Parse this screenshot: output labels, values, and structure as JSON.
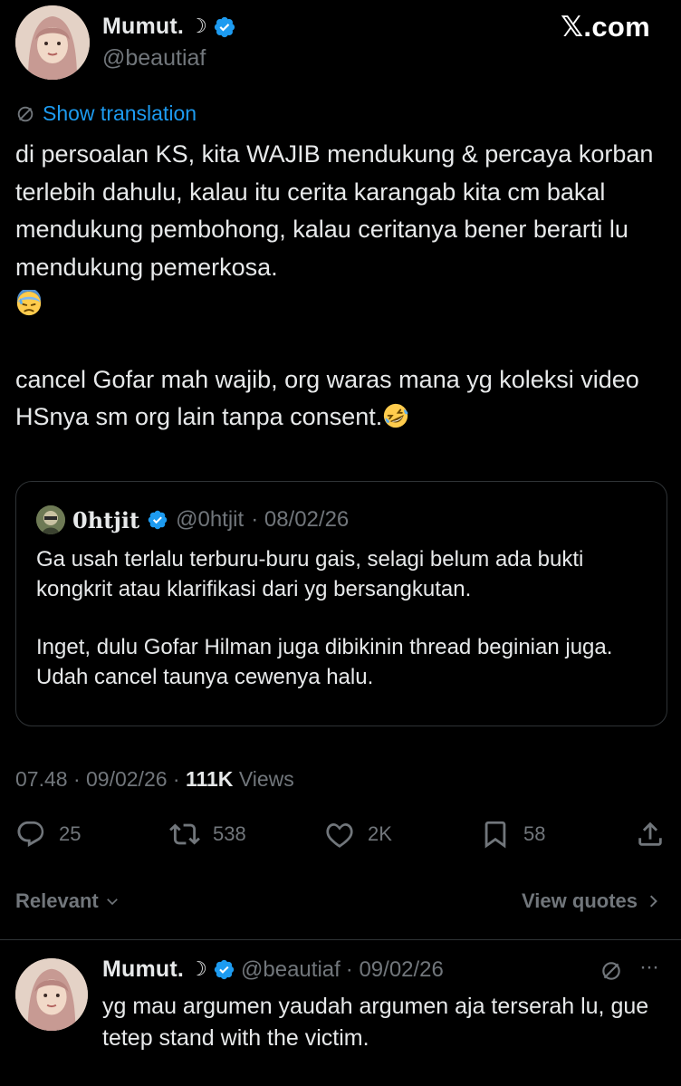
{
  "header": {
    "display_name": "Mumut.",
    "name_suffix": "☽",
    "handle": "@beautiaf",
    "site_label": "𝕏.com"
  },
  "tweet": {
    "show_translation": "Show translation",
    "paragraph1": "di persoalan KS, kita WAJIB mendukung & percaya korban terlebih dahulu, kalau itu cerita karangab kita cm bakal mendukung pembohong, kalau ceritanya bener berarti lu mendukung pemerkosa.",
    "paragraph2": "cancel Gofar mah wajib, org waras mana yg koleksi video HSnya sm org lain tanpa consent.",
    "emoji1": "downcast-face-with-sweat",
    "emoji2": "rolling-on-floor-laughing"
  },
  "quote": {
    "name": "0htjit",
    "handle": "@0htjit",
    "date": "· 08/02/26",
    "paragraph1": "Ga usah terlalu terburu-buru gais, selagi belum ada bukti kongkrit atau klarifikasi dari yg bersangkutan.",
    "paragraph2": "Inget, dulu Gofar Hilman juga dibikinin thread beginian juga. Udah cancel taunya cewenya halu."
  },
  "meta": {
    "time": "07.48 · 09/02/26 ·",
    "views_count": "111K",
    "views_label": "Views"
  },
  "actions": {
    "replies": "25",
    "reposts": "538",
    "likes": "2K",
    "bookmarks": "58"
  },
  "sort": {
    "relevant": "Relevant",
    "view_quotes": "View quotes"
  },
  "reply": {
    "display_name": "Mumut.",
    "name_suffix": "☽",
    "handle": "@beautiaf",
    "date": "· 09/02/26",
    "more": "···",
    "text": "yg mau argumen yaudah argumen aja terserah lu, gue tetep stand with the victim."
  },
  "colors": {
    "background": "#000000",
    "text": "#e7e9ea",
    "muted": "#71767b",
    "accent": "#1d9bf0",
    "border": "#2f3336"
  }
}
